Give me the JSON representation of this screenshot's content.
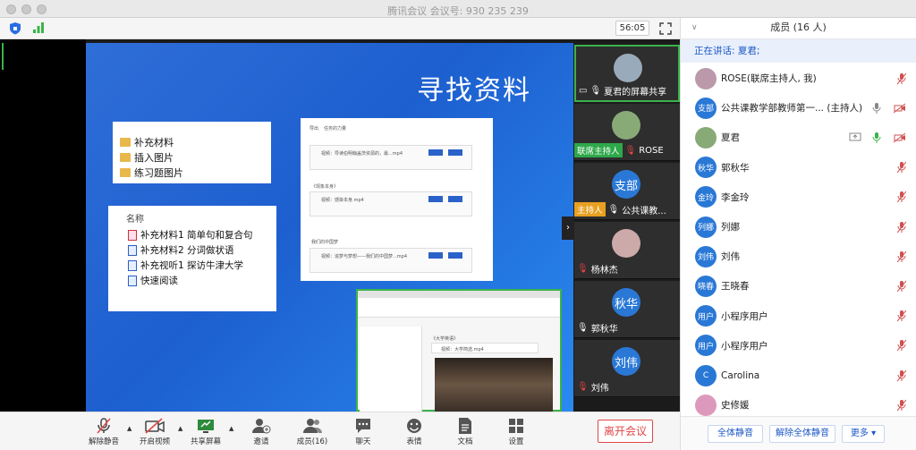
{
  "window": {
    "title": "腾讯会议 会议号: 930 235 239"
  },
  "toolbar": {
    "timer": "56:05"
  },
  "slide": {
    "title": "寻找资料",
    "folders": [
      "补充材料",
      "插入图片",
      "练习题图片"
    ],
    "file_header": "名称",
    "files": [
      "补充材料1 简单句和复合句",
      "补充材料2 分词做状语",
      "补充视听1 探访牛津大学",
      "快速阅读"
    ]
  },
  "shared_doc": {
    "tabs": [
      "导出",
      "任务的力量"
    ],
    "section1": "《现象本身》",
    "section2": "我们的中国梦",
    "item1": "视频：导读伯明翰盖茨资源的，最...mp4",
    "item2": "视频：感染本身.mp4",
    "item3": "视频：追梦与梦想——我们的中国梦...mp4",
    "btn_a": "查看",
    "btn_b": "插入试题"
  },
  "inner_doc": {
    "heading": "《大学英语》",
    "item": "视频：大学简选.mp4"
  },
  "video_tiles": [
    {
      "name": "夏君的屏幕共享",
      "tag": "",
      "avatar": "",
      "color": "#999"
    },
    {
      "name": "ROSE",
      "tag": "联席主持人",
      "avatar": "",
      "color": "#8a7"
    },
    {
      "name": "公共课教...",
      "tag": "主持人",
      "avatar": "支部",
      "color": "#2a78d6"
    },
    {
      "name": "杨林杰",
      "tag": "",
      "avatar": "",
      "color": "#caa"
    },
    {
      "name": "郭秋华",
      "tag": "",
      "avatar": "秋华",
      "color": "#2a78d6"
    },
    {
      "name": "刘伟",
      "tag": "",
      "avatar": "刘伟",
      "color": "#2a78d6"
    }
  ],
  "bottom": {
    "unmute": "解除静音",
    "video": "开启视频",
    "share": "共享屏幕",
    "invite": "邀请",
    "members": "成员(16)",
    "chat": "聊天",
    "emoji": "表情",
    "docs": "文档",
    "settings": "设置",
    "leave": "离开会议"
  },
  "panel": {
    "title": "成员 (16 人)",
    "speaking": "正在讲话: 夏君;",
    "members": [
      {
        "avatar": "",
        "name": "ROSE(联席主持人, 我)",
        "color": "#b9a",
        "mic": "muted"
      },
      {
        "avatar": "支部",
        "name": "公共课教学部教师第一...  (主持人)",
        "color": "#2a78d6",
        "mic": "on"
      },
      {
        "avatar": "",
        "name": "夏君",
        "color": "#8a7",
        "mic": "active"
      },
      {
        "avatar": "秋华",
        "name": "郭秋华",
        "color": "#2a78d6",
        "mic": "muted"
      },
      {
        "avatar": "金玲",
        "name": "李金玲",
        "color": "#2a78d6",
        "mic": "muted"
      },
      {
        "avatar": "列娜",
        "name": "列娜",
        "color": "#2a78d6",
        "mic": "muted"
      },
      {
        "avatar": "刘伟",
        "name": "刘伟",
        "color": "#2a78d6",
        "mic": "muted"
      },
      {
        "avatar": "晓春",
        "name": "王晓春",
        "color": "#2a78d6",
        "mic": "muted"
      },
      {
        "avatar": "用户",
        "name": "小程序用户",
        "color": "#2a78d6",
        "mic": "muted"
      },
      {
        "avatar": "用户",
        "name": "小程序用户",
        "color": "#2a78d6",
        "mic": "muted"
      },
      {
        "avatar": "C",
        "name": "Carolina",
        "color": "#2a78d6",
        "mic": "muted"
      },
      {
        "avatar": "",
        "name": "史修媛",
        "color": "#d9b",
        "mic": "muted"
      }
    ],
    "mute_all": "全体静音",
    "unmute_all": "解除全体静音",
    "more": "更多"
  }
}
